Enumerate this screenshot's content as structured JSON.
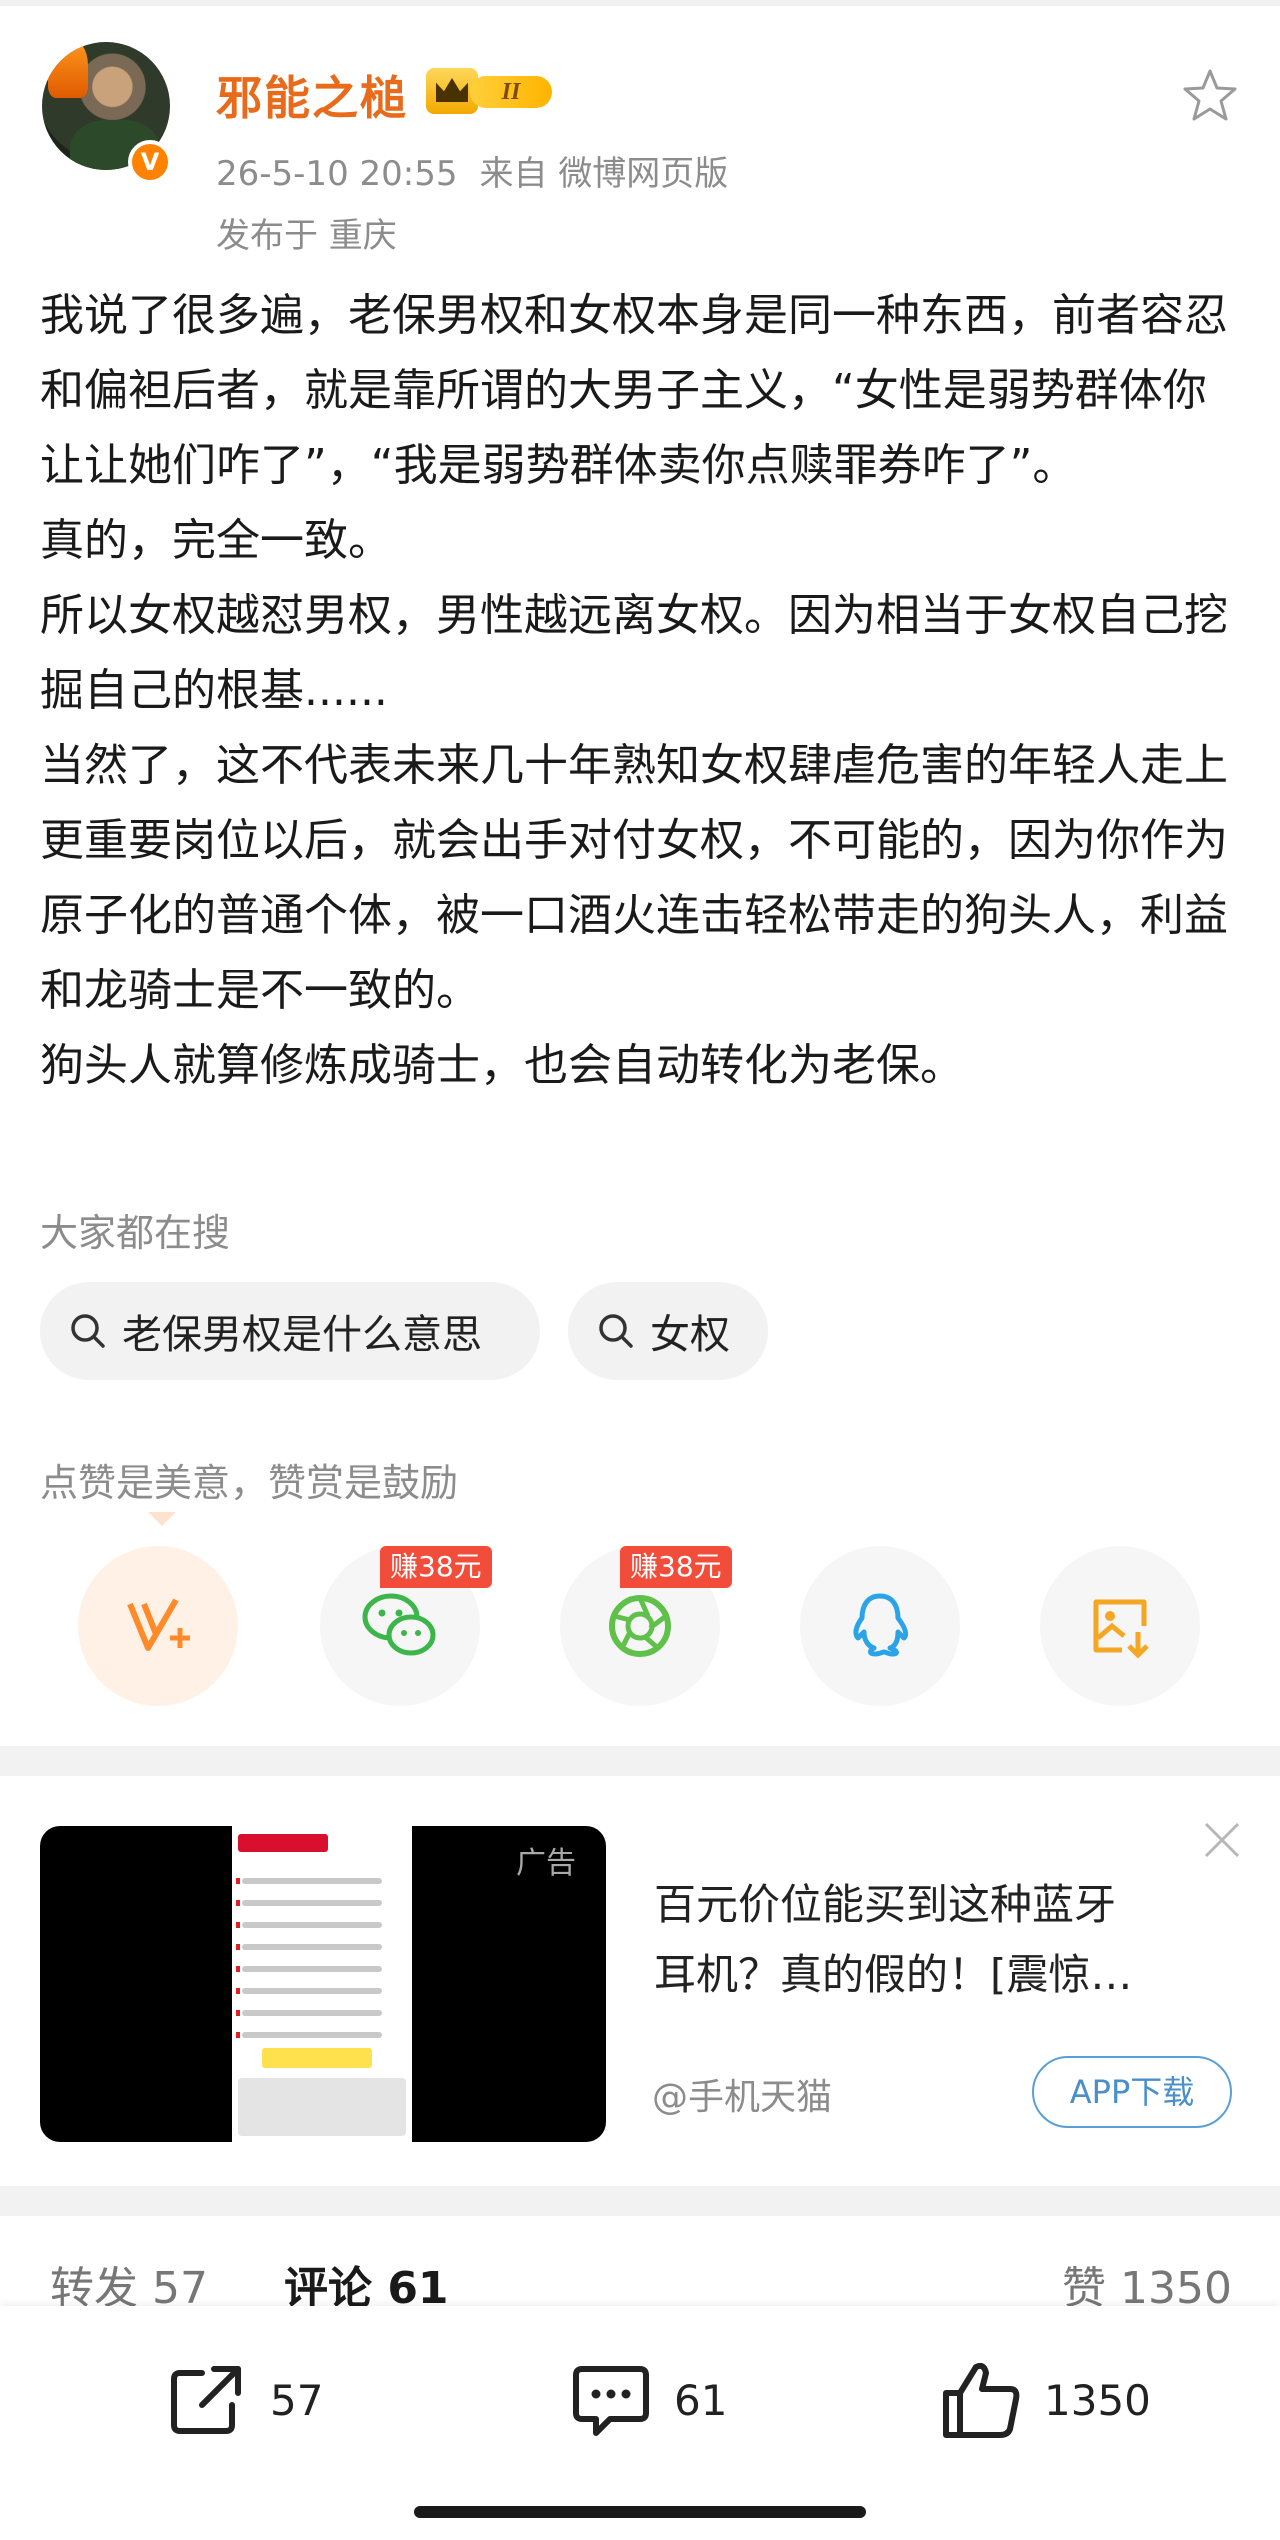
{
  "post": {
    "author": "邪能之槌",
    "level_badge": "II",
    "time": "26-5-10 20:55",
    "source_label": "来自",
    "source": "微博网页版",
    "location": "发布于 重庆",
    "body": [
      "我说了很多遍，老保男权和女权本身是同一种东西，前者容忍和偏袒后者，就是靠所谓的大男子主义，“女性是弱势群体你让让她们咋了”，“我是弱势群体卖你点赎罪券咋了”。",
      "真的，完全一致。",
      "所以女权越怼男权，男性越远离女权。因为相当于女权自己挖掘自己的根基......",
      "当然了，这不代表未来几十年熟知女权肆虐危害的年轻人走上更重要岗位以后，就会出手对付女权，不可能的，因为你作为原子化的普通个体，被一口酒火连击轻松带走的狗头人，利益和龙骑士是不一致的。",
      "狗头人就算修炼成骑士，也会自动转化为老保。"
    ]
  },
  "search": {
    "title": "大家都在搜",
    "chips": [
      "老保男权是什么意思",
      "女权"
    ]
  },
  "reward": {
    "text": "点赞是美意，赞赏是鼓励",
    "earn_badge": "赚38元",
    "icons": [
      "vplus-icon",
      "wechat-icon",
      "moments-icon",
      "qq-icon",
      "save-image-icon"
    ]
  },
  "ad": {
    "tag": "广告",
    "title_lines": [
      "百元价位能买到这种蓝牙",
      "耳机？真的假的！[震惊…"
    ],
    "source": "@手机天猫",
    "button": "APP下载"
  },
  "tabs": {
    "repost": "转发 57",
    "comment": "评论 61",
    "like": "赞 1350"
  },
  "bottom_bar": {
    "repost_count": "57",
    "comment_count": "61",
    "like_count": "1350"
  },
  "colors": {
    "username": "#e86b1c",
    "verify": "#ff8200",
    "earn_badge": "#f24d3a",
    "ad_button": "#4a8fc9"
  }
}
